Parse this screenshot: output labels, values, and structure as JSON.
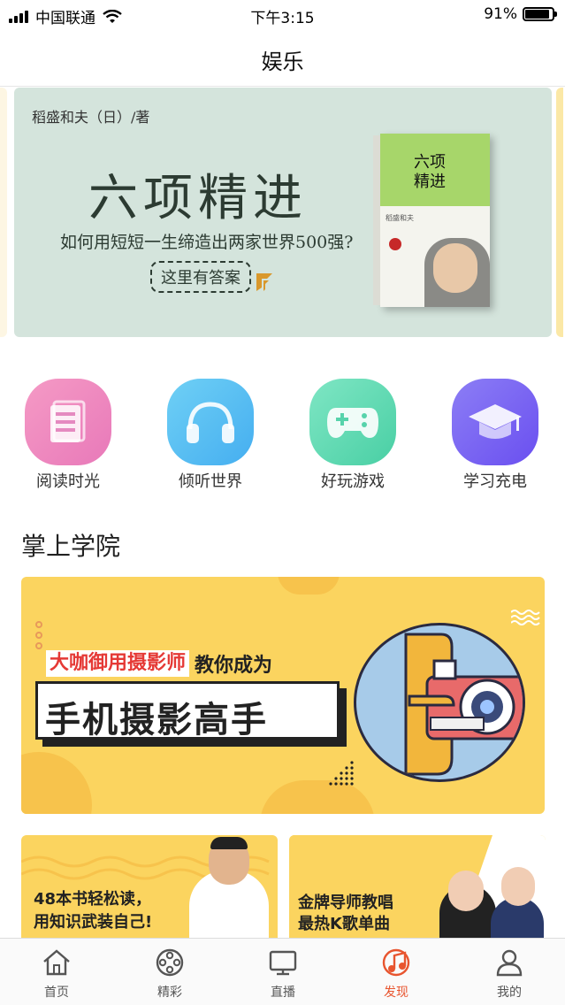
{
  "status_bar": {
    "carrier": "中国联通",
    "time": "下午3:15",
    "battery_text": "91%",
    "battery_level": 0.91
  },
  "header": {
    "title": "娱乐"
  },
  "banner": {
    "author": "稻盛和夫（日）/著",
    "title": "六项精进",
    "subtitle": "如何用短短一生缔造出两家世界500强?",
    "cta": "这里有答案",
    "book_title": "六项精进",
    "book_label": "稻盛和夫"
  },
  "menu": {
    "items": [
      {
        "label": "阅读时光",
        "icon": "book-icon",
        "color_from": "#f59ac5",
        "color_to": "#e879b9"
      },
      {
        "label": "倾听世界",
        "icon": "headphones-icon",
        "color_from": "#6fd0f5",
        "color_to": "#45aef0"
      },
      {
        "label": "好玩游戏",
        "icon": "gamepad-icon",
        "color_from": "#7fe6c4",
        "color_to": "#49cfa4"
      },
      {
        "label": "学习充电",
        "icon": "graduation-cap-icon",
        "color_from": "#8c7ef5",
        "color_to": "#6a4ff0"
      }
    ]
  },
  "section": {
    "title": "掌上学院"
  },
  "promo_main": {
    "highlight": "大咖御用摄影师",
    "tagline": "教你成为",
    "headline": "手机摄影高手"
  },
  "promo_left": {
    "line1": "48本书轻松读，",
    "line2": "用知识武装自己!"
  },
  "promo_right": {
    "line1": "金牌导师教唱",
    "line2": "最热K歌单曲"
  },
  "tab_bar": {
    "tabs": [
      {
        "label": "首页",
        "icon": "home-icon",
        "active": false
      },
      {
        "label": "精彩",
        "icon": "film-reel-icon",
        "active": false
      },
      {
        "label": "直播",
        "icon": "tv-icon",
        "active": false
      },
      {
        "label": "发现",
        "icon": "music-note-icon",
        "active": true
      },
      {
        "label": "我的",
        "icon": "user-icon",
        "active": false
      }
    ],
    "active_color": "#e8552f"
  }
}
